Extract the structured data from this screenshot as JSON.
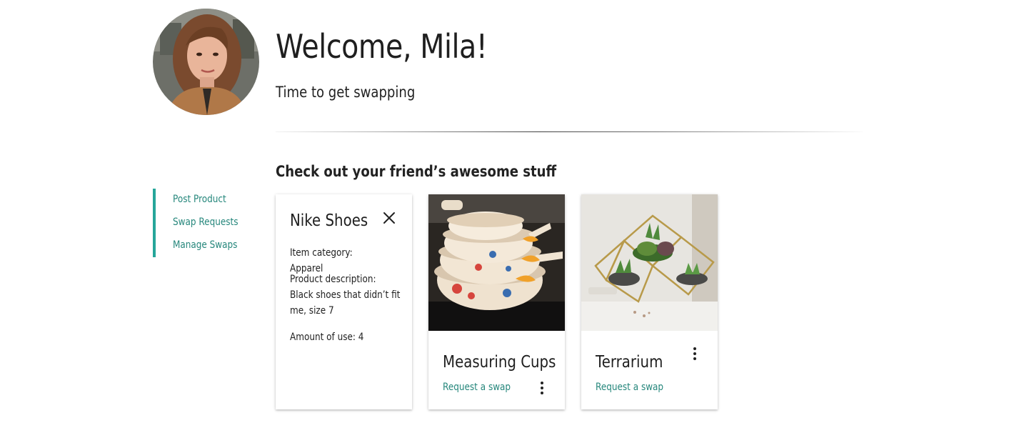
{
  "header": {
    "avatar_alt": "Profile photo",
    "title": "Welcome, Mila!",
    "subtitle": "Time to get swapping"
  },
  "sidebar": {
    "accent_color": "#26a69a",
    "items": [
      {
        "label": "Post Product"
      },
      {
        "label": "Swap Requests"
      },
      {
        "label": "Manage Swaps"
      }
    ]
  },
  "section": {
    "title": "Check out your friend’s awesome stuff"
  },
  "cards": [
    {
      "title": "Nike Shoes",
      "state": "revealed",
      "category_text": "Item category: Apparel",
      "description_text": "Product description: Black shoes that didn’t fit me, size 7",
      "usage_text": "Amount of use: 4",
      "icon": "close-icon"
    },
    {
      "title": "Measuring Cups",
      "state": "default",
      "image": "measuring-cups-photo",
      "action_label": "Request a swap",
      "icon": "more-vert-icon"
    },
    {
      "title": "Terrarium",
      "state": "default",
      "image": "terrarium-photo",
      "action_label": "Request a swap",
      "icon": "more-vert-icon"
    }
  ],
  "colors": {
    "link": "#26877c",
    "text": "#222222",
    "background": "#ffffff"
  }
}
